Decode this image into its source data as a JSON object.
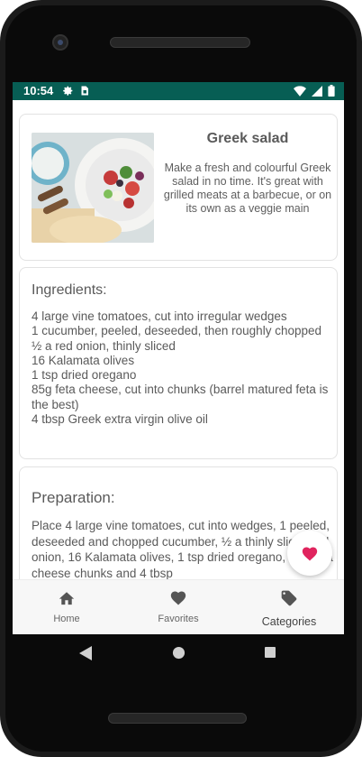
{
  "status_bar": {
    "time": "10:54",
    "icons": [
      "gear-icon",
      "sim-icon",
      "wifi-icon",
      "signal-icon",
      "battery-icon"
    ]
  },
  "recipe": {
    "title": "Greek salad",
    "description": "Make a fresh and colourful Greek salad in no time. It's great with grilled meats at a barbecue, or on its own as a veggie main"
  },
  "ingredients": {
    "heading": "Ingredients:",
    "items": [
      "4 large vine tomatoes, cut into irregular wedges",
      "1 cucumber, peeled, deseeded, then roughly chopped",
      "½ a red onion, thinly sliced",
      "16 Kalamata olives",
      "1 tsp dried oregano",
      "85g feta cheese, cut into chunks (barrel matured feta is the best)",
      "4 tbsp Greek extra virgin olive oil"
    ]
  },
  "preparation": {
    "heading": "Preparation:",
    "text": "Place 4 large vine tomatoes, cut into wedges, 1 peeled, deseeded and chopped cucumber, ½ a thinly sliced red onion, 16 Kalamata olives, 1 tsp dried oregano, 85g feta cheese chunks and 4 tbsp"
  },
  "fab": {
    "icon": "heart-icon",
    "color": "#e0245e"
  },
  "bottom_nav": {
    "items": [
      {
        "label": "Home",
        "icon": "home-icon"
      },
      {
        "label": "Favorites",
        "icon": "heart-icon"
      },
      {
        "label": "Categories",
        "icon": "tag-icon"
      }
    ]
  },
  "colors": {
    "status_bar": "#075e54",
    "accent": "#e0245e"
  }
}
